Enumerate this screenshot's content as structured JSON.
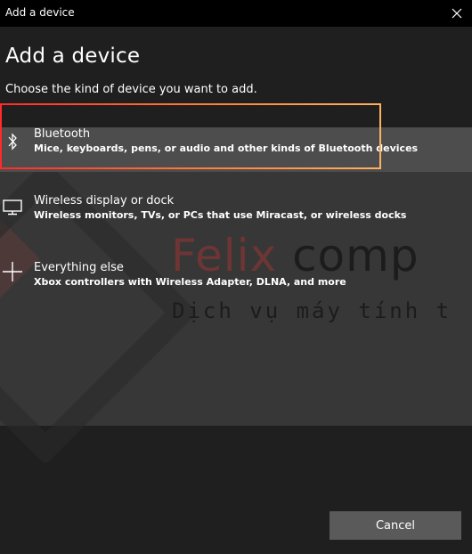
{
  "window": {
    "title": "Add a device",
    "close_label": "×"
  },
  "header": {
    "title": "Add a device",
    "subtitle": "Choose the kind of device you want to add."
  },
  "options": [
    {
      "title": "Bluetooth",
      "description": "Mice, keyboards, pens, or audio and other kinds of Bluetooth devices",
      "icon": "bluetooth-icon"
    },
    {
      "title": "Wireless display or dock",
      "description": "Wireless monitors, TVs, or PCs that use Miracast, or wireless docks",
      "icon": "monitor-icon"
    },
    {
      "title": "Everything else",
      "description": "Xbox controllers with Wireless Adapter, DLNA, and more",
      "icon": "plus-icon"
    }
  ],
  "watermark": {
    "brand_red": "Felix",
    "brand_grey": " comp",
    "tagline": "Dịch vụ máy tính t"
  },
  "footer": {
    "cancel_label": "Cancel"
  },
  "colors": {
    "titlebar": "#000000",
    "background": "#1f1f1f",
    "selected_row": "#4d4d4d",
    "button": "#5a5a5a",
    "highlight_start": "#ff2a2a",
    "highlight_end": "#ffb060"
  }
}
